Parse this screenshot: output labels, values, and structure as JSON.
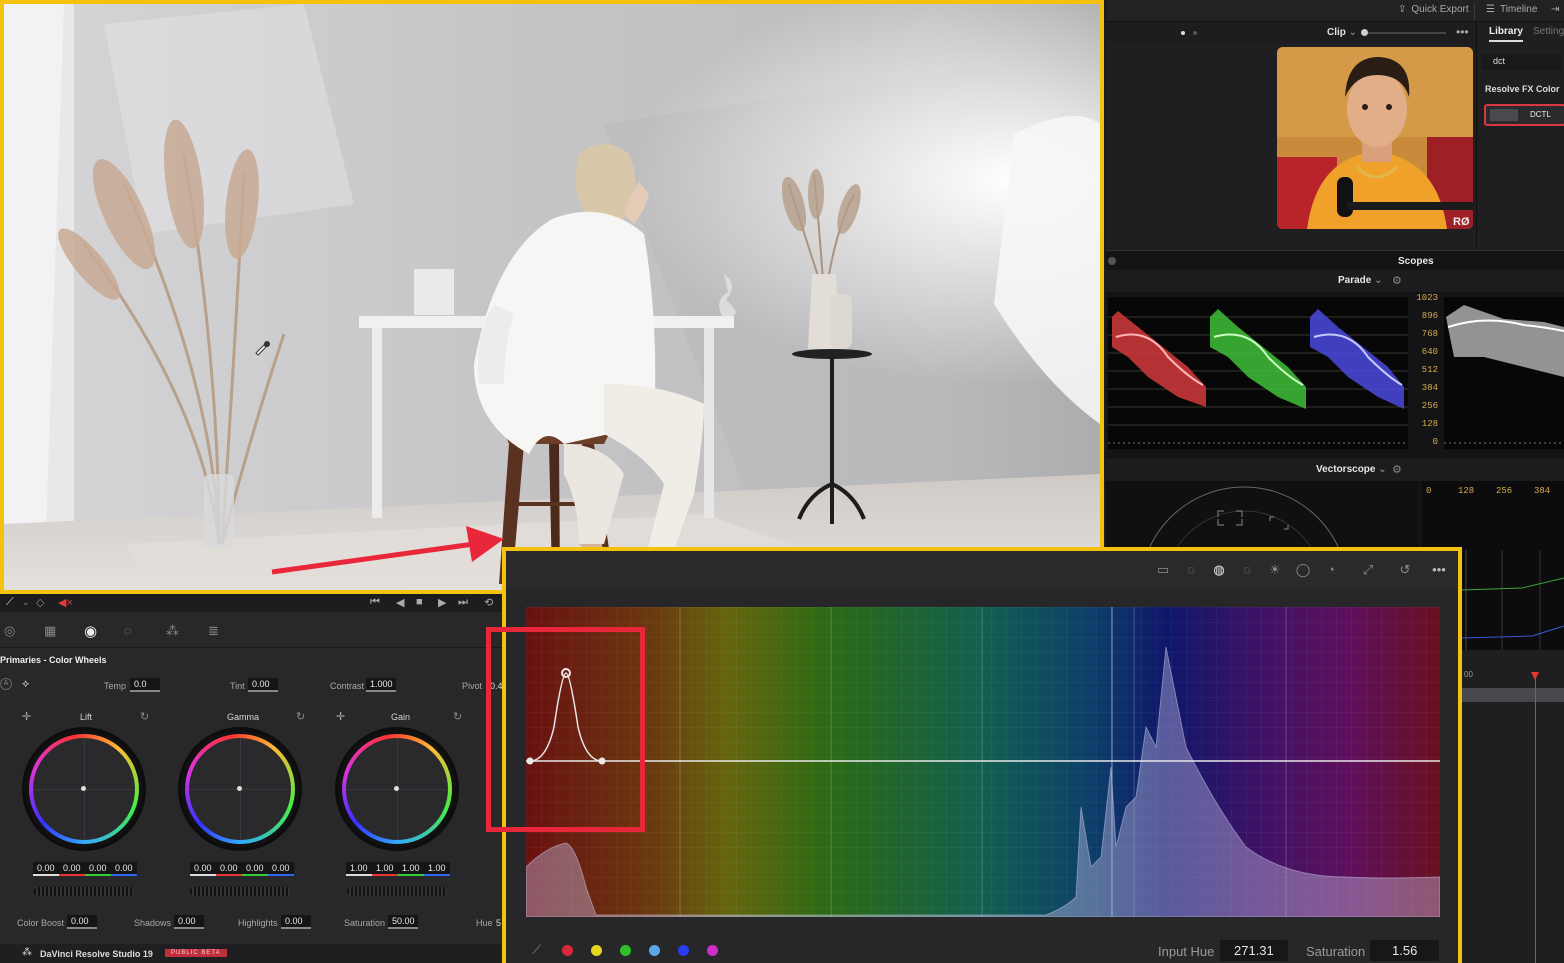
{
  "topbar": {
    "quick_export": "Quick Export",
    "timeline": "Timeline"
  },
  "clipbar": {
    "clip_label": "Clip"
  },
  "library": {
    "tab_library": "Library",
    "tab_settings": "Setting",
    "search_value": "dct",
    "section": "Resolve FX Color",
    "effect_name": "DCTL"
  },
  "scopes": {
    "title": "Scopes",
    "parade_label": "Parade",
    "vector_label": "Vectorscope",
    "parade_scale": [
      "1023",
      "896",
      "768",
      "640",
      "512",
      "384",
      "256",
      "128",
      "0"
    ],
    "histogram_scale": [
      "0",
      "128",
      "256",
      "384"
    ]
  },
  "primaries": {
    "title": "Primaries - Color Wheels",
    "temp_label": "Temp",
    "temp_value": "0.0",
    "tint_label": "Tint",
    "tint_value": "0.00",
    "contrast_label": "Contrast",
    "contrast_value": "1.000",
    "pivot_label": "Pivot",
    "pivot_value": "0.4",
    "lift": {
      "label": "Lift",
      "values": [
        "0.00",
        "0.00",
        "0.00",
        "0.00"
      ]
    },
    "gamma": {
      "label": "Gamma",
      "values": [
        "0.00",
        "0.00",
        "0.00",
        "0.00"
      ]
    },
    "gain": {
      "label": "Gain",
      "values": [
        "1.00",
        "1.00",
        "1.00",
        "1.00"
      ]
    },
    "color_boost_label": "Color Boost",
    "color_boost_value": "0.00",
    "shadows_label": "Shadows",
    "shadows_value": "0.00",
    "highlights_label": "Highlights",
    "highlights_value": "0.00",
    "saturation_label": "Saturation",
    "saturation_value": "50.00",
    "hue_label": "Hue",
    "hue_value": "5"
  },
  "app": {
    "name": "DaVinci Resolve Studio 19",
    "badge": "PUBLIC BETA"
  },
  "curves": {
    "input_hue_label": "Input Hue",
    "input_hue_value": "271.31",
    "saturation_label": "Saturation",
    "saturation_value": "1.56"
  },
  "timeline": {
    "timecode": "00"
  },
  "colors": {
    "accent": "#f4c20d",
    "highlight_box": "#e8283a"
  }
}
